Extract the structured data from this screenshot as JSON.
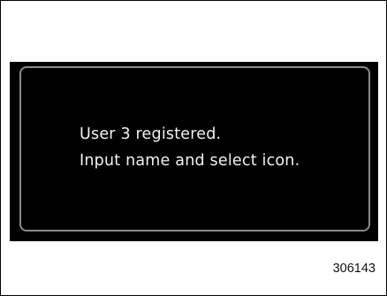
{
  "screen": {
    "message_lines": [
      "User 3 registered.",
      "Input name and select icon."
    ]
  },
  "figure": {
    "id": "306143"
  },
  "colors": {
    "screen_background": "#000000",
    "screen_border": "#8a8a8a",
    "message_text": "#f2f2f2",
    "page_background": "#ffffff"
  }
}
